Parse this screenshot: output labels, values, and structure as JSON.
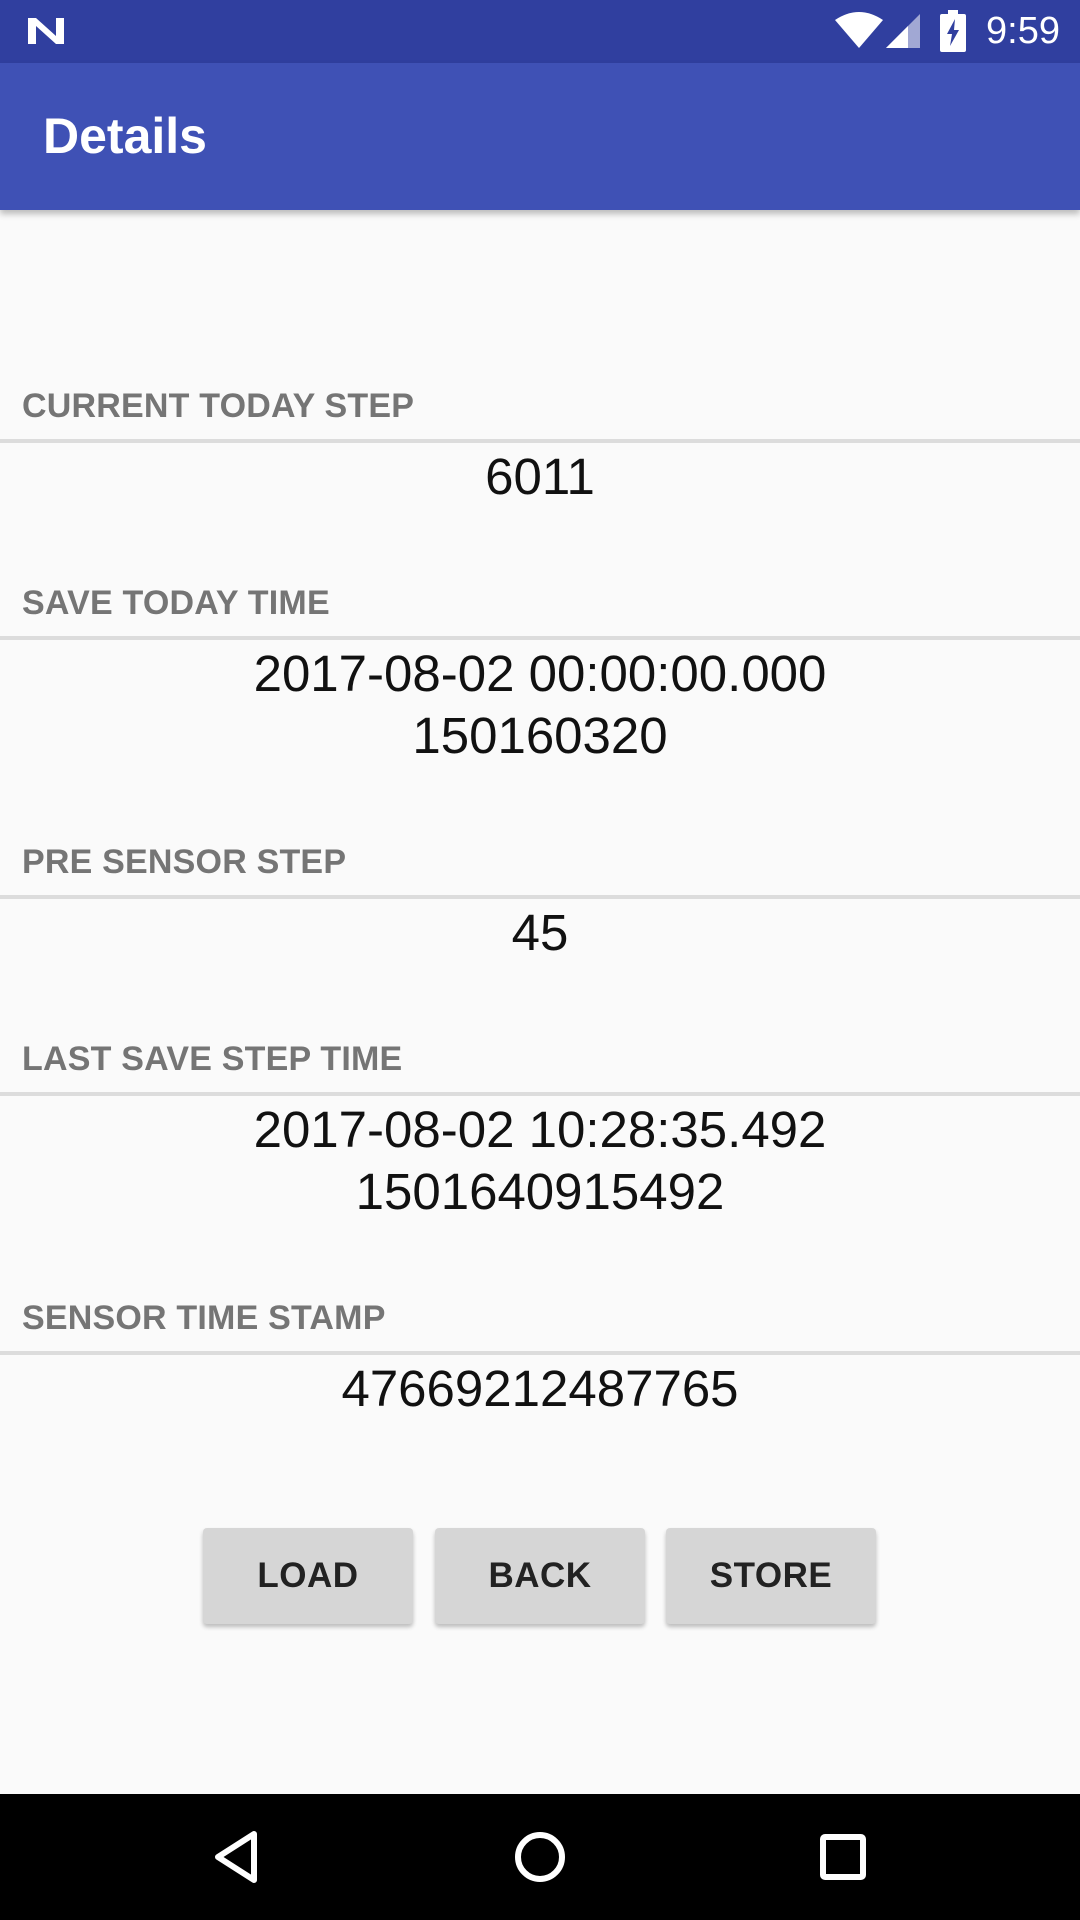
{
  "status_bar": {
    "time": "9:59",
    "icons": [
      "notification-n-icon",
      "wifi-icon",
      "cellular-signal-icon",
      "battery-charging-icon"
    ]
  },
  "app_bar": {
    "title": "Details"
  },
  "sections": [
    {
      "label": "CURRENT TODAY STEP",
      "value": "6011"
    },
    {
      "label": "SAVE TODAY TIME",
      "value": "2017-08-02 00:00:00.000\n150160320"
    },
    {
      "label": "PRE SENSOR STEP",
      "value": "45"
    },
    {
      "label": "LAST SAVE STEP TIME",
      "value": "2017-08-02 10:28:35.492\n1501640915492"
    },
    {
      "label": "SENSOR TIME STAMP",
      "value": "47669212487765"
    }
  ],
  "buttons": {
    "load": "LOAD",
    "back": "BACK",
    "store": "STORE"
  },
  "nav_bar": {
    "icons": [
      "back-triangle-icon",
      "home-circle-icon",
      "recents-square-icon"
    ]
  },
  "colors": {
    "status_bar": "#303f9f",
    "app_bar": "#3f51b5",
    "background": "#fafafa",
    "label": "#757575",
    "button": "#d6d6d6"
  }
}
